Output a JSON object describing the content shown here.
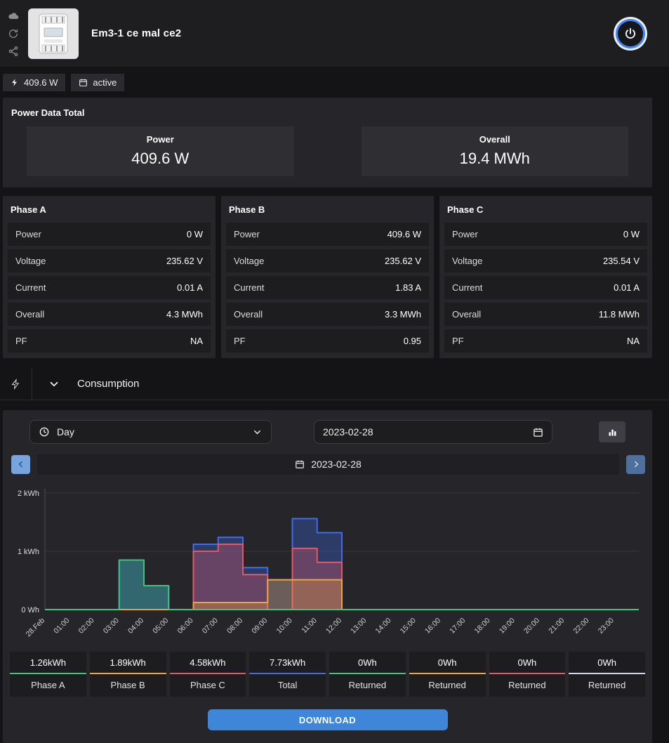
{
  "header": {
    "title": "Em3-1 ce mal ce2"
  },
  "badges": {
    "power": "409.6 W",
    "status": "active"
  },
  "power_total": {
    "title": "Power Data Total",
    "boxes": [
      {
        "label": "Power",
        "value": "409.6 W"
      },
      {
        "label": "Overall",
        "value": "19.4 MWh"
      }
    ]
  },
  "phases": [
    {
      "title": "Phase A",
      "rows": [
        {
          "label": "Power",
          "value": "0 W"
        },
        {
          "label": "Voltage",
          "value": "235.62 V"
        },
        {
          "label": "Current",
          "value": "0.01 A"
        },
        {
          "label": "Overall",
          "value": "4.3 MWh"
        },
        {
          "label": "PF",
          "value": "NA"
        }
      ]
    },
    {
      "title": "Phase B",
      "rows": [
        {
          "label": "Power",
          "value": "409.6 W"
        },
        {
          "label": "Voltage",
          "value": "235.62 V"
        },
        {
          "label": "Current",
          "value": "1.83 A"
        },
        {
          "label": "Overall",
          "value": "3.3 MWh"
        },
        {
          "label": "PF",
          "value": "0.95"
        }
      ]
    },
    {
      "title": "Phase C",
      "rows": [
        {
          "label": "Power",
          "value": "0 W"
        },
        {
          "label": "Voltage",
          "value": "235.54 V"
        },
        {
          "label": "Current",
          "value": "0.01 A"
        },
        {
          "label": "Overall",
          "value": "11.8 MWh"
        },
        {
          "label": "PF",
          "value": "NA"
        }
      ]
    }
  ],
  "consumption": {
    "title": "Consumption",
    "period_value": "Day",
    "date_value": "2023-02-28",
    "nav_date": "2023-02-28",
    "download_label": "DOWNLOAD"
  },
  "stats": [
    {
      "value": "1.26kWh",
      "label": "Phase A",
      "color": "#3fc380"
    },
    {
      "value": "1.89kWh",
      "label": "Phase B",
      "color": "#f1a43c"
    },
    {
      "value": "4.58kWh",
      "label": "Phase C",
      "color": "#e45865"
    },
    {
      "value": "7.73kWh",
      "label": "Total",
      "color": "#3d6de8"
    },
    {
      "value": "0Wh",
      "label": "Returned",
      "color": "#3fc380"
    },
    {
      "value": "0Wh",
      "label": "Returned",
      "color": "#f1a43c"
    },
    {
      "value": "0Wh",
      "label": "Returned",
      "color": "#e45865"
    },
    {
      "value": "0Wh",
      "label": "Returned",
      "color": "#cfd9e6"
    }
  ],
  "chart_data": {
    "type": "area",
    "title": "Consumption 2023-02-28 (kWh per hour, step)",
    "x": [
      "28.Feb",
      "01:00",
      "02:00",
      "03:00",
      "04:00",
      "05:00",
      "06:00",
      "07:00",
      "08:00",
      "09:00",
      "10:00",
      "11:00",
      "12:00",
      "13:00",
      "14:00",
      "15:00",
      "16:00",
      "17:00",
      "18:00",
      "19:00",
      "20:00",
      "21:00",
      "22:00",
      "23:00"
    ],
    "series": [
      {
        "name": "Phase A",
        "color": "#3fc380",
        "values": [
          0,
          0,
          0,
          0.85,
          0.41,
          0,
          0,
          0,
          0,
          0,
          0,
          0,
          0,
          0,
          0,
          0,
          0,
          0,
          0,
          0,
          0,
          0,
          0,
          0
        ]
      },
      {
        "name": "Phase B",
        "color": "#f1a43c",
        "values": [
          0,
          0,
          0,
          0,
          0,
          0,
          0.12,
          0.12,
          0.12,
          0.51,
          0.51,
          0.51,
          0,
          0,
          0,
          0,
          0,
          0,
          0,
          0,
          0,
          0,
          0,
          0
        ]
      },
      {
        "name": "Phase C",
        "color": "#e45865",
        "values": [
          0,
          0,
          0,
          0,
          0,
          0,
          1.0,
          1.12,
          0.6,
          0,
          1.05,
          0.81,
          0,
          0,
          0,
          0,
          0,
          0,
          0,
          0,
          0,
          0,
          0,
          0
        ]
      },
      {
        "name": "Total",
        "color": "#3d6de8",
        "values": [
          0,
          0,
          0,
          0.85,
          0.41,
          0,
          1.12,
          1.24,
          0.72,
          0.51,
          1.56,
          1.32,
          0,
          0,
          0,
          0,
          0,
          0,
          0,
          0,
          0,
          0,
          0,
          0
        ]
      }
    ],
    "ylim": [
      0,
      2
    ],
    "yticks": [
      [
        0,
        "0 Wh"
      ],
      [
        1,
        "1 kWh"
      ],
      [
        2,
        "2 kWh"
      ]
    ],
    "grid": true,
    "legend_position": "none"
  }
}
